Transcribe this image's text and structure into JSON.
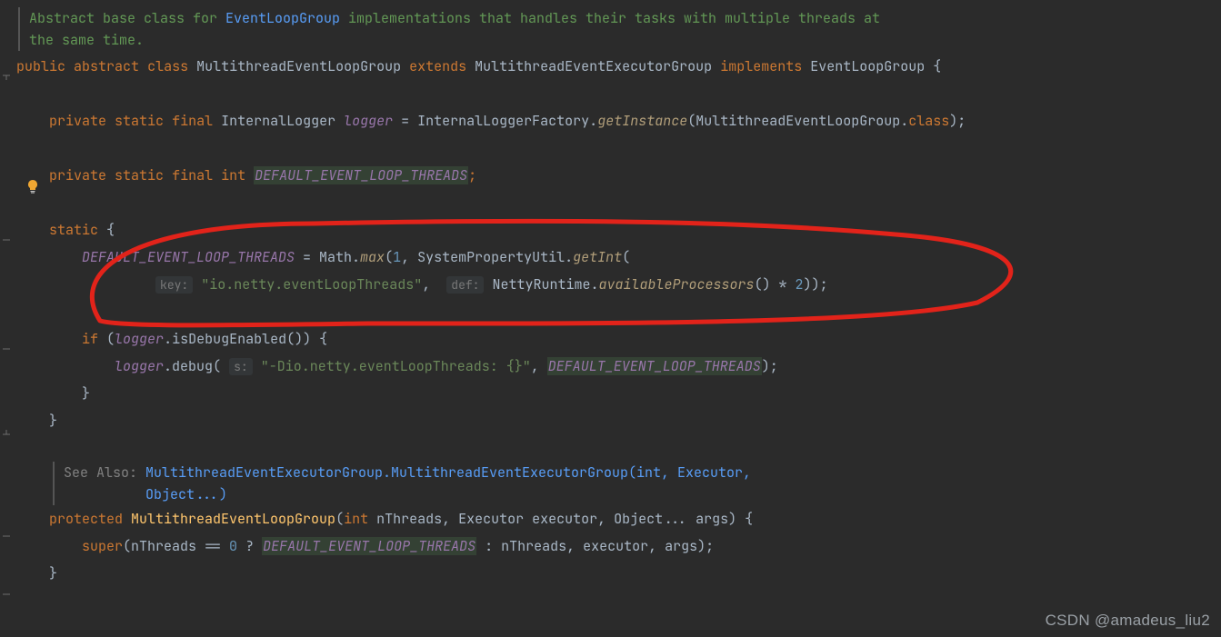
{
  "doc1": {
    "part1": "Abstract base class for ",
    "link": "EventLoopGroup",
    "part2": " implementations that handles their tasks with multiple threads at",
    "part3": "the same time."
  },
  "decl": {
    "public": "public",
    "abstract": "abstract",
    "class": "class",
    "name": "MultithreadEventLoopGroup",
    "extends": "extends",
    "super": "MultithreadEventExecutorGroup",
    "implements": "implements",
    "iface": "EventLoopGroup",
    "brace": " {"
  },
  "loggerLine": {
    "private": "private",
    "static": "static",
    "final": "final",
    "type": "InternalLogger",
    "name": "logger",
    "eq": " = ",
    "factory": "InternalLoggerFactory.",
    "call": "getInstance",
    "arg_pre": "(MultithreadEventLoopGroup.",
    "cls": "class",
    "end": ");"
  },
  "constLine": {
    "private": "private",
    "static": "static",
    "final": "final",
    "int": "int",
    "name": "DEFAULT_EVENT_LOOP_THREADS",
    "semi": ";"
  },
  "staticBlock": {
    "static_kw": "static",
    "open": " {",
    "field": "DEFAULT_EVENT_LOOP_THREADS",
    "eq": " = Math.",
    "max": "max",
    "p1": "(",
    "one": "1",
    "comma": ", ",
    "spu": "SystemPropertyUtil.",
    "getInt": "getInt",
    "p2": "(",
    "hint_key": "key:",
    "str_key": "\"io.netty.eventLoopThreads\"",
    "comma2": ", ",
    "hint_def": "def:",
    "nr": "NettyRuntime.",
    "ap": "availableProcessors",
    "tail": "() * ",
    "two": "2",
    "end": "));",
    "if_kw": "if",
    "if_open": " (",
    "logger": "logger",
    "dot1": ".isDebugEnabled()) {",
    "logger2": "logger",
    "dot2": ".debug(",
    "hint_s": "s:",
    "str2": "\"-Dio.netty.eventLoopThreads: {}\"",
    "comma3": ", ",
    "field2": "DEFAULT_EVENT_LOOP_THREADS",
    "end2": ");",
    "close_if": "}",
    "close_static": "}"
  },
  "doc2": {
    "see": "See Also:",
    "link": "MultithreadEventExecutorGroup.MultithreadEventExecutorGroup(int, Executor,",
    "link2": "Object...)"
  },
  "ctor": {
    "protected": "protected",
    "name": "MultithreadEventLoopGroup",
    "open": "(",
    "int": "int",
    "p1": " nThreads, Executor executor, Object... args) {",
    "super": "super",
    "p2": "(nThreads == ",
    "zero": "0",
    "q": " ? ",
    "field": "DEFAULT_EVENT_LOOP_THREADS",
    "rest": " : nThreads, executor, args);",
    "close": "}"
  },
  "watermark": "CSDN @amadeus_liu2"
}
